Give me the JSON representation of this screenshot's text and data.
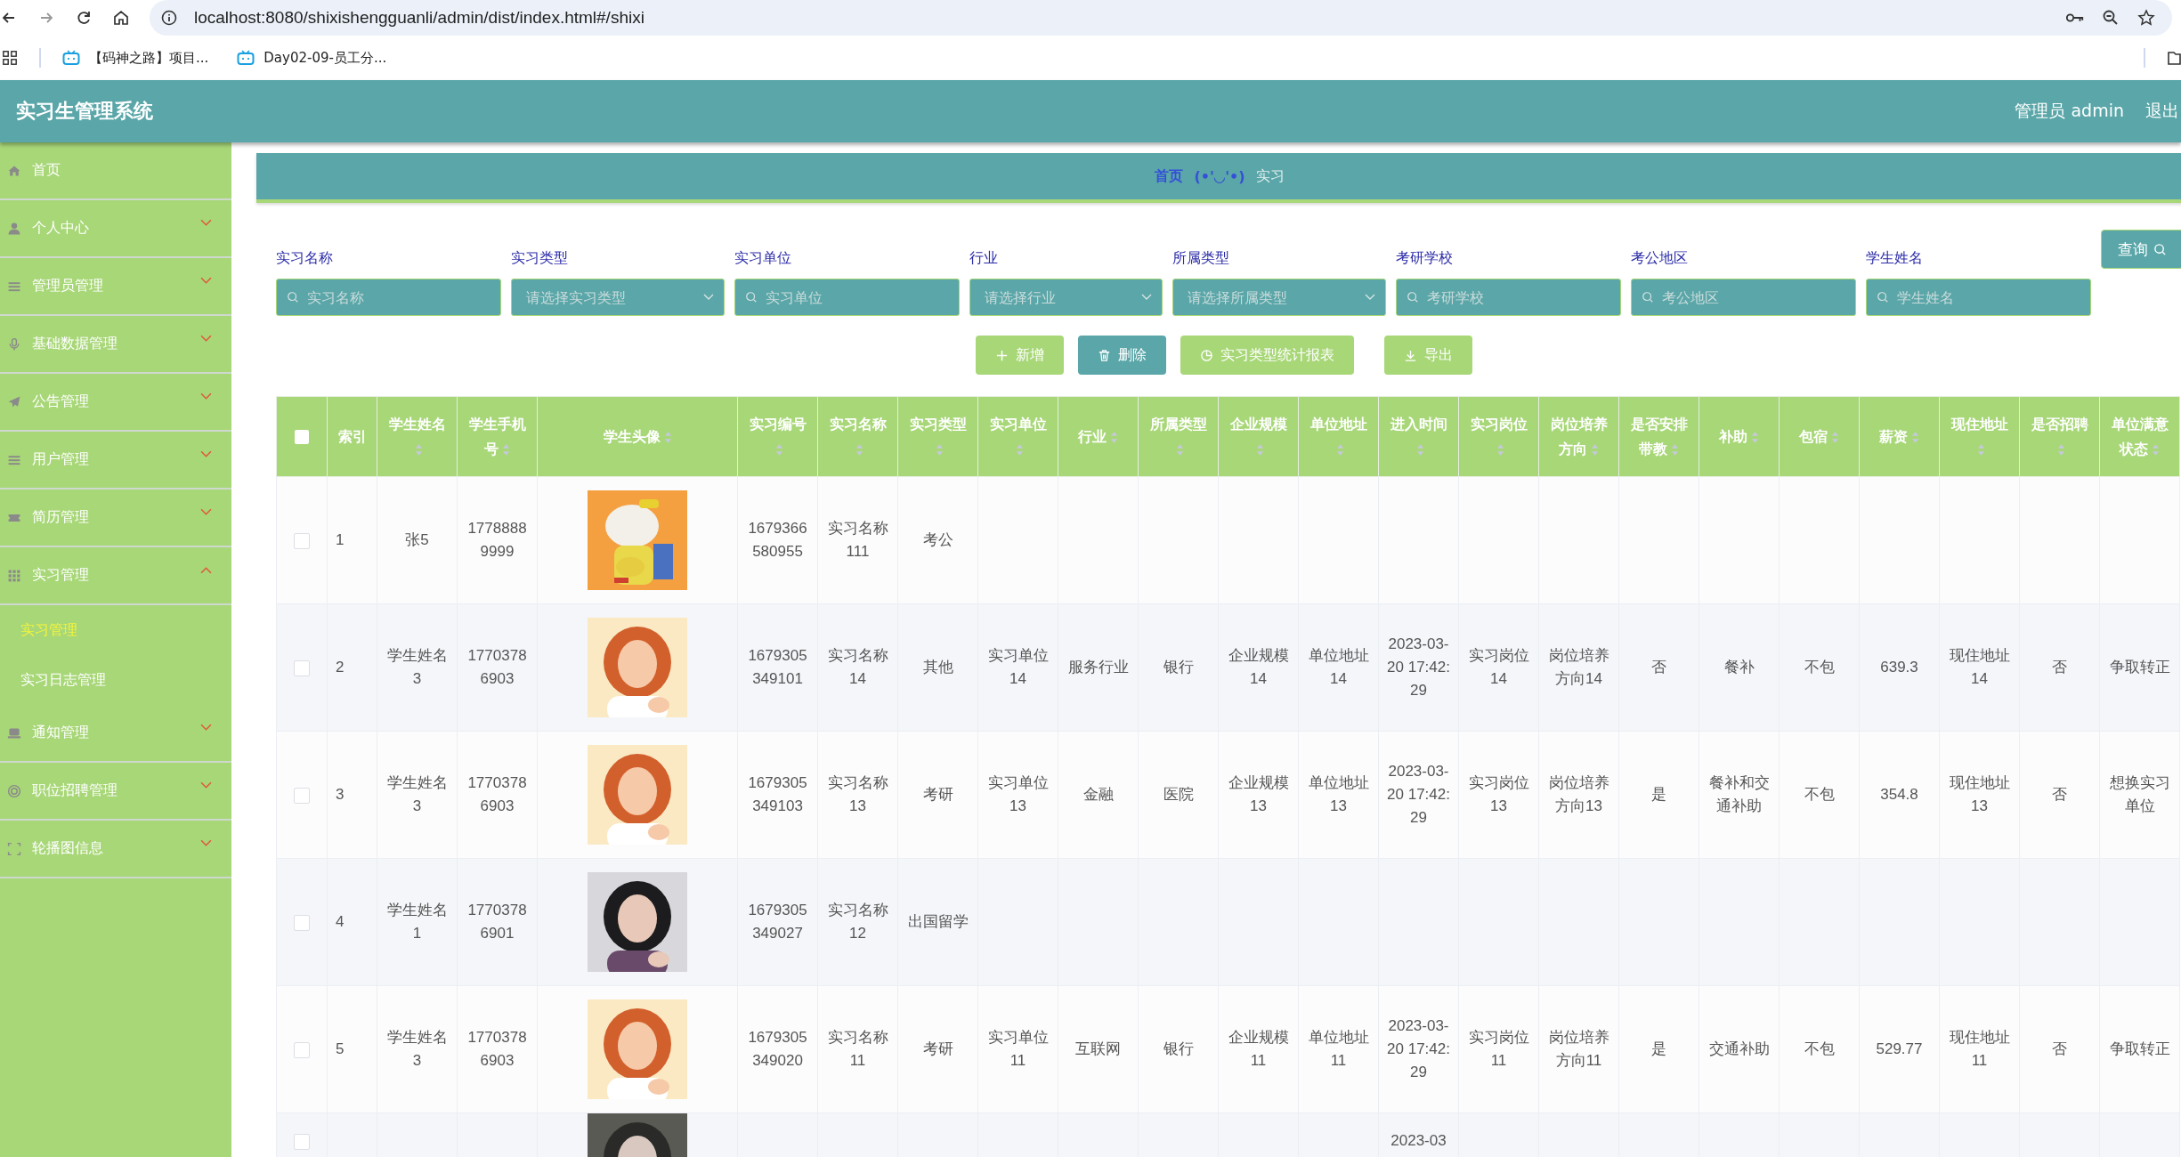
{
  "browser": {
    "url": "localhost:8080/shixishengguanli/admin/dist/index.html#/shixi",
    "bookmarks": [
      "【码神之路】项目...",
      "Day02-09-员工分..."
    ]
  },
  "header": {
    "title": "实习生管理系统",
    "user": "管理员 admin",
    "logout": "退出"
  },
  "sidebar": {
    "items": [
      {
        "label": "首页",
        "kind": "link"
      },
      {
        "label": "个人中心",
        "kind": "menu",
        "expanded": false
      },
      {
        "label": "管理员管理",
        "kind": "menu",
        "expanded": false
      },
      {
        "label": "基础数据管理",
        "kind": "menu",
        "expanded": false
      },
      {
        "label": "公告管理",
        "kind": "menu",
        "expanded": false
      },
      {
        "label": "用户管理",
        "kind": "menu",
        "expanded": false
      },
      {
        "label": "简历管理",
        "kind": "menu",
        "expanded": false
      },
      {
        "label": "实习管理",
        "kind": "menu",
        "expanded": true,
        "children": [
          {
            "label": "实习管理",
            "selected": true
          },
          {
            "label": "实习日志管理",
            "selected": false
          }
        ]
      },
      {
        "label": "通知管理",
        "kind": "menu",
        "expanded": false
      },
      {
        "label": "职位招聘管理",
        "kind": "menu",
        "expanded": false
      },
      {
        "label": "轮播图信息",
        "kind": "menu",
        "expanded": false
      }
    ]
  },
  "breadcrumb": {
    "home": "首页",
    "separator": "(•'◡'•)",
    "current": "实习"
  },
  "filters": [
    {
      "label": "实习名称",
      "kind": "input",
      "placeholder": "实习名称"
    },
    {
      "label": "实习类型",
      "kind": "select",
      "placeholder": "请选择实习类型"
    },
    {
      "label": "实习单位",
      "kind": "input",
      "placeholder": "实习单位"
    },
    {
      "label": "行业",
      "kind": "select",
      "placeholder": "请选择行业"
    },
    {
      "label": "所属类型",
      "kind": "select",
      "placeholder": "请选择所属类型"
    },
    {
      "label": "考研学校",
      "kind": "input",
      "placeholder": "考研学校"
    },
    {
      "label": "考公地区",
      "kind": "input",
      "placeholder": "考公地区"
    },
    {
      "label": "学生姓名",
      "kind": "input",
      "placeholder": "学生姓名"
    }
  ],
  "search_button": "查询",
  "actions": [
    {
      "label": "新增",
      "kind": "add"
    },
    {
      "label": "删除",
      "kind": "delete"
    },
    {
      "label": "实习类型统计报表",
      "kind": "chart"
    },
    {
      "label": "导出",
      "kind": "export"
    }
  ],
  "table": {
    "select_all": {
      "checked": false
    },
    "columns": [
      {
        "label": "索引",
        "sortable": false
      },
      {
        "label": "学生姓名",
        "sortable": true
      },
      {
        "label": "学生手机号",
        "sortable": true
      },
      {
        "label": "学生头像",
        "sortable": true,
        "kind": "picture"
      },
      {
        "label": "实习编号",
        "sortable": true
      },
      {
        "label": "实习名称",
        "sortable": true
      },
      {
        "label": "实习类型",
        "sortable": true
      },
      {
        "label": "实习单位",
        "sortable": true
      },
      {
        "label": "行业",
        "sortable": true
      },
      {
        "label": "所属类型",
        "sortable": true
      },
      {
        "label": "企业规模",
        "sortable": true
      },
      {
        "label": "单位地址",
        "sortable": true
      },
      {
        "label": "进入时间",
        "sortable": true
      },
      {
        "label": "实习岗位",
        "sortable": true
      },
      {
        "label": "岗位培养方向",
        "sortable": true
      },
      {
        "label": "是否安排带教",
        "sortable": true
      },
      {
        "label": "补助",
        "sortable": true
      },
      {
        "label": "包宿",
        "sortable": true
      },
      {
        "label": "薪资",
        "sortable": true
      },
      {
        "label": "现住地址",
        "sortable": true
      },
      {
        "label": "是否招聘",
        "sortable": true
      },
      {
        "label": "单位满意状态",
        "sortable": true
      }
    ],
    "rows": [
      {
        "checked": false,
        "cells": [
          "1",
          "张5",
          "17788889999",
          null,
          "1679366580955",
          "实习名称111",
          "考公",
          null,
          null,
          null,
          null,
          null,
          null,
          null,
          null,
          null,
          null,
          null,
          null,
          null,
          null,
          null
        ]
      },
      {
        "checked": false,
        "cells": [
          "2",
          "学生姓名3",
          "17703786903",
          null,
          "1679305349101",
          "实习名称14",
          "其他",
          "实习单位14",
          "服务行业",
          "银行",
          "企业规模14",
          "单位地址14",
          "2023-03-20 17:42:29",
          "实习岗位14",
          "岗位培养方向14",
          "否",
          "餐补",
          "不包",
          "639.3",
          "现住地址14",
          "否",
          "争取转正"
        ]
      },
      {
        "checked": false,
        "cells": [
          "3",
          "学生姓名3",
          "17703786903",
          null,
          "1679305349103",
          "实习名称13",
          "考研",
          "实习单位13",
          "金融",
          "医院",
          "企业规模13",
          "单位地址13",
          "2023-03-20 17:42:29",
          "实习岗位13",
          "岗位培养方向13",
          "是",
          "餐补和交通补助",
          "不包",
          "354.8",
          "现住地址13",
          "否",
          "想换实习单位"
        ]
      },
      {
        "checked": false,
        "cells": [
          "4",
          "学生姓名1",
          "17703786901",
          null,
          "1679305349027",
          "实习名称12",
          "出国留学",
          null,
          null,
          null,
          null,
          null,
          null,
          null,
          null,
          null,
          null,
          null,
          null,
          null,
          null,
          null
        ]
      },
      {
        "checked": false,
        "cells": [
          "5",
          "学生姓名3",
          "17703786903",
          null,
          "1679305349020",
          "实习名称11",
          "考研",
          "实习单位11",
          "互联网",
          "银行",
          "企业规模11",
          "单位地址11",
          "2023-03-20 17:42:29",
          "实习岗位11",
          "岗位培养方向11",
          "是",
          "交通补助",
          "不包",
          "529.77",
          "现住地址11",
          "否",
          "争取转正"
        ]
      },
      {
        "checked": false,
        "cells": [
          null,
          null,
          null,
          null,
          null,
          null,
          null,
          null,
          null,
          null,
          null,
          null,
          "2023-03",
          null,
          null,
          null,
          null,
          null,
          null,
          null,
          null,
          null
        ]
      }
    ]
  }
}
